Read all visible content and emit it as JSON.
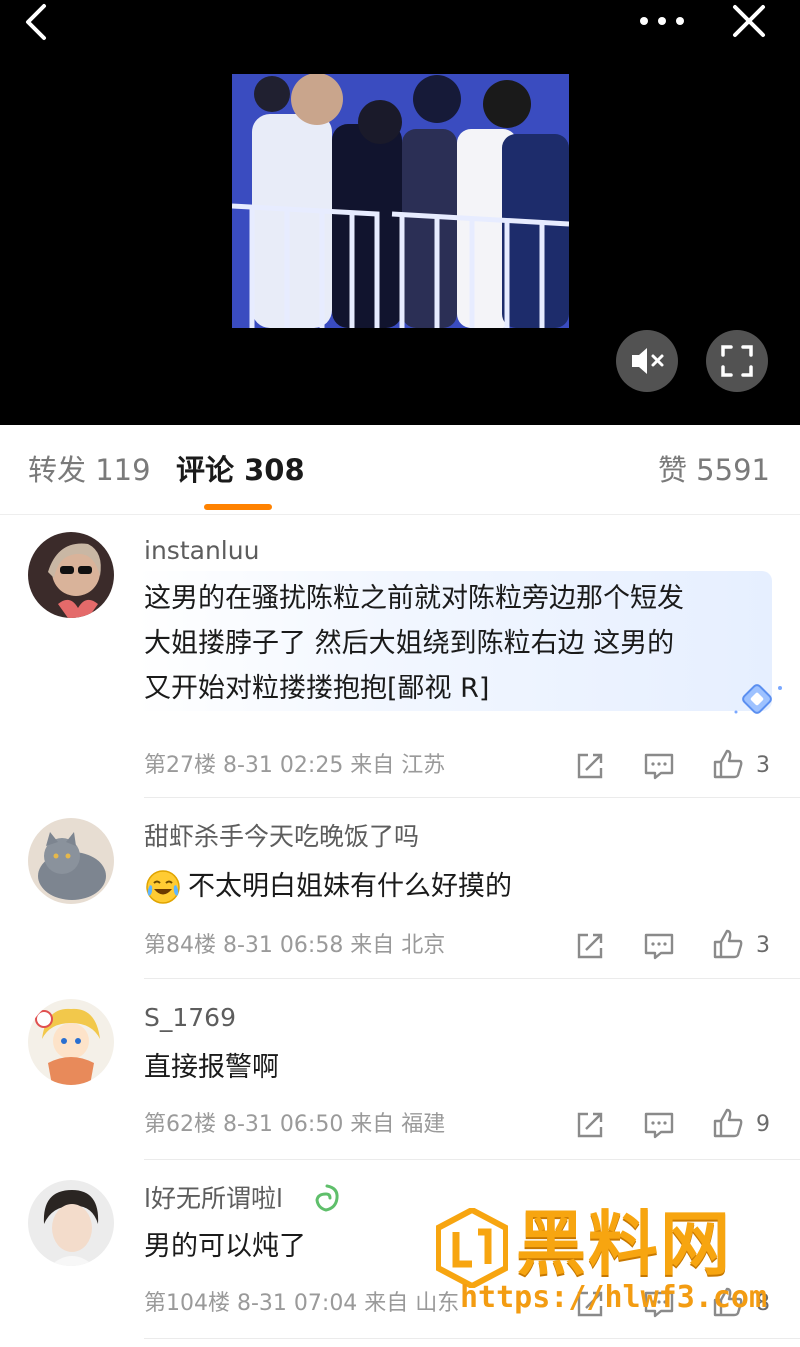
{
  "colors": {
    "accent": "#ff8200",
    "video_bg": "#000000",
    "meta_text": "#9a9a9a",
    "watermark": "#f7a510"
  },
  "nav": {
    "back_icon": "chevron-left-icon",
    "more_icon": "more-horizontal-icon",
    "close_icon": "close-icon"
  },
  "video": {
    "mute_icon": "volume-mute-icon",
    "fullscreen_icon": "fullscreen-icon"
  },
  "tabs": {
    "repost": "转发 119",
    "comment": "评论 308",
    "like": "赞 5591",
    "active": "comment"
  },
  "comments": [
    {
      "username": "instanluu",
      "lines": [
        "这男的在骚扰陈粒之前就对陈粒旁边那个短发",
        "大姐搂脖子了 然后大姐绕到陈粒右边  这男的",
        "又开始对粒搂搂抱抱[鄙视 R]"
      ],
      "meta": "第27楼  8-31 02:25  来自 江苏",
      "likes": "3"
    },
    {
      "username": "甜虾杀手今天吃晚饭了吗",
      "lines": [
        "不太明白姐妹有什么好摸的"
      ],
      "emoji": "crying-laugh-emoji",
      "meta": "第84楼  8-31 06:58  来自 北京",
      "likes": "3"
    },
    {
      "username": "S_1769",
      "lines": [
        "直接报警啊"
      ],
      "meta": "第62楼  8-31 06:50  来自 福建",
      "likes": "9"
    },
    {
      "username": "l好无所谓啦l",
      "lines": [
        "男的可以炖了"
      ],
      "badge": "vip-badge-icon",
      "meta": "第104楼  8-31 07:04  来自 山东",
      "likes": "8"
    }
  ],
  "watermark": {
    "title": "黑料网",
    "url": "https://hlwf3.com"
  }
}
